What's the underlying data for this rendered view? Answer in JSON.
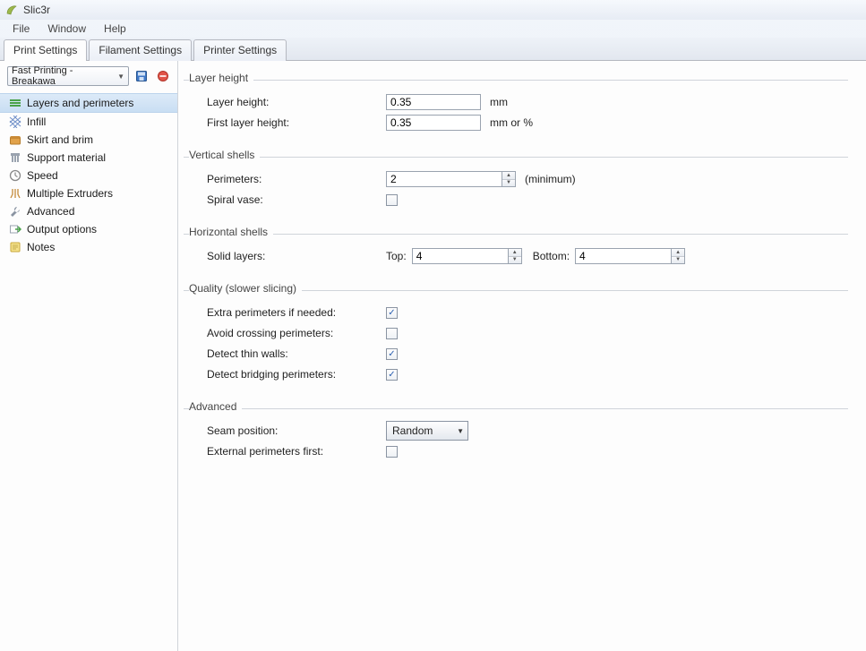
{
  "app": {
    "title": "Slic3r"
  },
  "menu": {
    "file": "File",
    "window": "Window",
    "help": "Help"
  },
  "tabs": {
    "print": "Print Settings",
    "filament": "Filament Settings",
    "printer": "Printer Settings"
  },
  "preset": {
    "selected": "Fast Printing - Breakawa"
  },
  "sidebar": {
    "items": [
      {
        "label": "Layers and perimeters"
      },
      {
        "label": "Infill"
      },
      {
        "label": "Skirt and brim"
      },
      {
        "label": "Support material"
      },
      {
        "label": "Speed"
      },
      {
        "label": "Multiple Extruders"
      },
      {
        "label": "Advanced"
      },
      {
        "label": "Output options"
      },
      {
        "label": "Notes"
      }
    ]
  },
  "groups": {
    "layer_height": {
      "title": "Layer height",
      "layer_height_label": "Layer height:",
      "layer_height_value": "0.35",
      "layer_height_unit": "mm",
      "first_layer_label": "First layer height:",
      "first_layer_value": "0.35",
      "first_layer_unit": "mm or %"
    },
    "vertical_shells": {
      "title": "Vertical shells",
      "perimeters_label": "Perimeters:",
      "perimeters_value": "2",
      "perimeters_suffix": "(minimum)",
      "spiral_label": "Spiral vase:",
      "spiral_checked": false
    },
    "horizontal_shells": {
      "title": "Horizontal shells",
      "solid_layers_label": "Solid layers:",
      "top_label": "Top:",
      "top_value": "4",
      "bottom_label": "Bottom:",
      "bottom_value": "4"
    },
    "quality": {
      "title": "Quality (slower slicing)",
      "extra_perimeters_label": "Extra perimeters if needed:",
      "extra_perimeters_checked": true,
      "avoid_crossing_label": "Avoid crossing perimeters:",
      "avoid_crossing_checked": false,
      "detect_thin_label": "Detect thin walls:",
      "detect_thin_checked": true,
      "detect_bridging_label": "Detect bridging perimeters:",
      "detect_bridging_checked": true
    },
    "advanced": {
      "title": "Advanced",
      "seam_label": "Seam position:",
      "seam_value": "Random",
      "external_first_label": "External perimeters first:",
      "external_first_checked": false
    }
  }
}
